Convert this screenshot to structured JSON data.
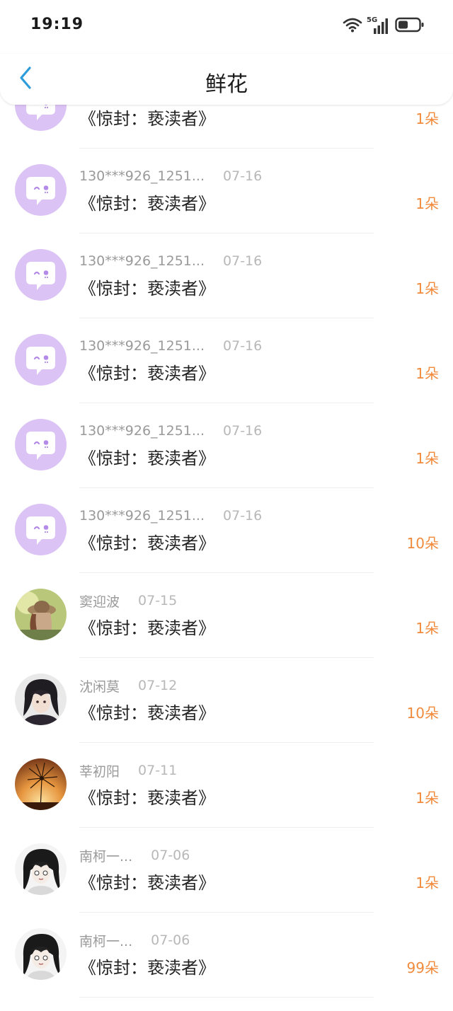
{
  "status_bar": {
    "time": "19:19",
    "network_label": "5G",
    "icons": [
      "wifi-icon",
      "signal-icon",
      "battery-icon"
    ]
  },
  "header": {
    "title": "鲜花",
    "back_icon": "chevron-left-icon"
  },
  "colors": {
    "accent": "#2d9cdb",
    "flower_count": "#f08a3c",
    "placeholder_avatar": "#dcc3f5"
  },
  "records": [
    {
      "user": "",
      "date": "",
      "book": "《惊封：亵渎者》",
      "count": "1朵",
      "avatar": "placeholder"
    },
    {
      "user": "130***926_1251...",
      "date": "07-16",
      "book": "《惊封：亵渎者》",
      "count": "1朵",
      "avatar": "placeholder"
    },
    {
      "user": "130***926_1251...",
      "date": "07-16",
      "book": "《惊封：亵渎者》",
      "count": "1朵",
      "avatar": "placeholder"
    },
    {
      "user": "130***926_1251...",
      "date": "07-16",
      "book": "《惊封：亵渎者》",
      "count": "1朵",
      "avatar": "placeholder"
    },
    {
      "user": "130***926_1251...",
      "date": "07-16",
      "book": "《惊封：亵渎者》",
      "count": "1朵",
      "avatar": "placeholder"
    },
    {
      "user": "130***926_1251...",
      "date": "07-16",
      "book": "《惊封：亵渎者》",
      "count": "10朵",
      "avatar": "placeholder"
    },
    {
      "user": "窦迎波",
      "date": "07-15",
      "book": "《惊封：亵渎者》",
      "count": "1朵",
      "avatar": "photo-girl-hat"
    },
    {
      "user": "沈闲莫",
      "date": "07-12",
      "book": "《惊封：亵渎者》",
      "count": "10朵",
      "avatar": "photo-anime-boy"
    },
    {
      "user": "莘初阳",
      "date": "07-11",
      "book": "《惊封：亵渎者》",
      "count": "1朵",
      "avatar": "photo-dandelion-sunset"
    },
    {
      "user": "南柯一...",
      "date": "07-06",
      "book": "《惊封：亵渎者》",
      "count": "1朵",
      "avatar": "photo-anime-girl"
    },
    {
      "user": "南柯一...",
      "date": "07-06",
      "book": "《惊封：亵渎者》",
      "count": "99朵",
      "avatar": "photo-anime-girl"
    }
  ]
}
